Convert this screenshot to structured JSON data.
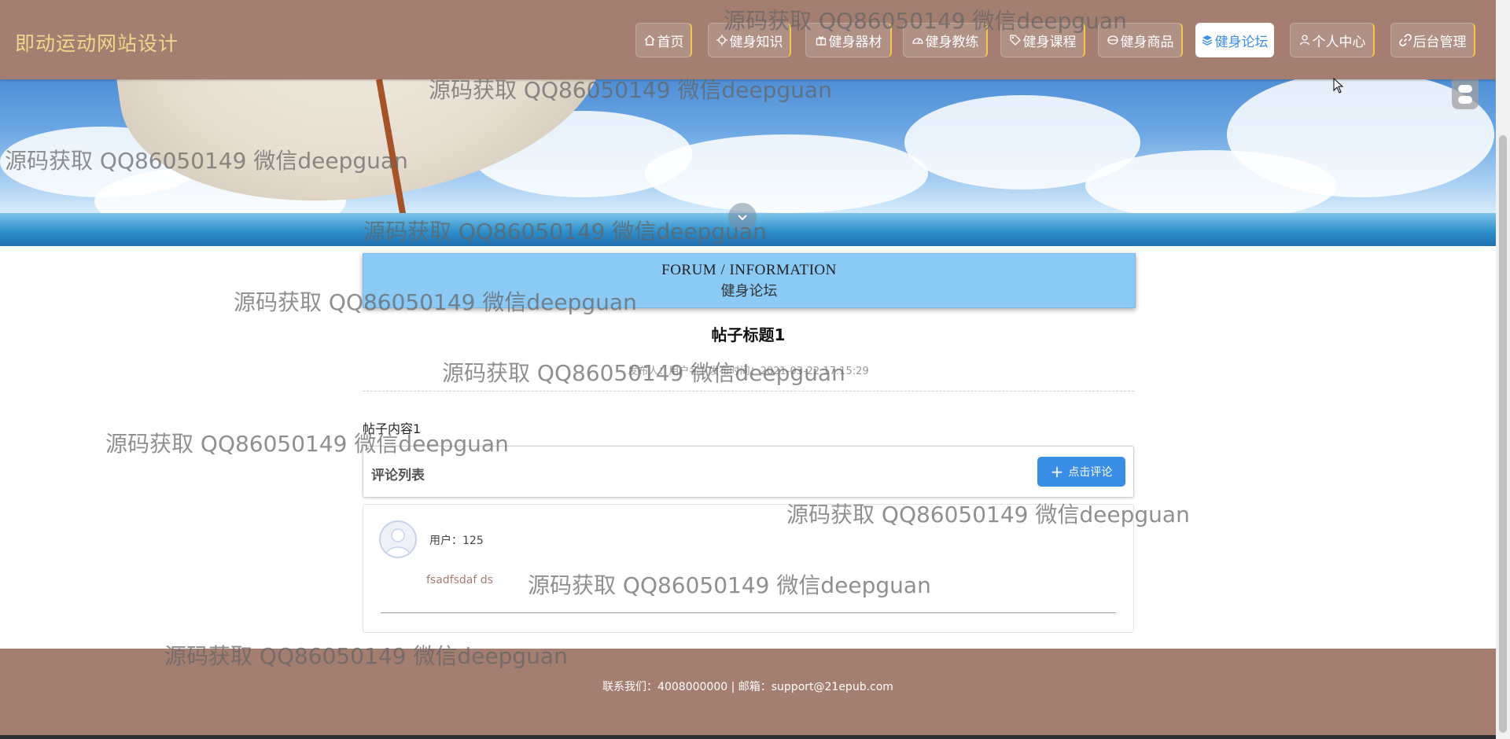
{
  "site": {
    "title": "即动运动网站设计"
  },
  "nav": [
    {
      "label": "首页",
      "icon": "home-icon"
    },
    {
      "label": "健身知识",
      "icon": "sparkle-icon"
    },
    {
      "label": "健身器材",
      "icon": "gift-icon"
    },
    {
      "label": "健身教练",
      "icon": "speedometer-icon"
    },
    {
      "label": "健身课程",
      "icon": "tag-icon"
    },
    {
      "label": "健身商品",
      "icon": "box-icon"
    },
    {
      "label": "健身论坛",
      "icon": "layers-icon",
      "active": true
    },
    {
      "label": "个人中心",
      "icon": "user-icon"
    },
    {
      "label": "后台管理",
      "icon": "link-icon"
    }
  ],
  "section": {
    "en": "FORUM / INFORMATION",
    "cn": "健身论坛"
  },
  "post": {
    "title": "帖子标题1",
    "meta": "发布人：用户名1 发布时间：2021-03-22 17:15:29",
    "content": "帖子内容1"
  },
  "comments": {
    "header": "评论列表",
    "button_label": "点击评论",
    "items": [
      {
        "user": "用户：125",
        "text": "fsadfsdaf ds"
      }
    ]
  },
  "footer": {
    "text": "联系我们：4008000000 | 邮箱：support@21epub.com"
  },
  "watermark": "源码获取 QQ86050149 微信deepguan",
  "colors": {
    "header_bg": "#a57e72",
    "title": "#f3d58b",
    "accent": "#3a8ee6",
    "section_bg": "#8ccaf6"
  }
}
